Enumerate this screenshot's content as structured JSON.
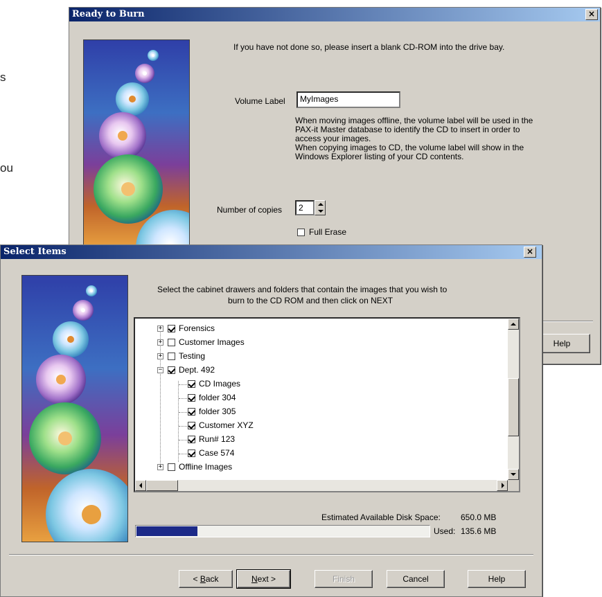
{
  "background_text": {
    "line1": "s",
    "line2": "ou"
  },
  "ready_to_burn": {
    "title": "Ready to Burn",
    "close_label": "×",
    "instruction": "If you have not done so, please insert a blank CD-ROM into the drive bay.",
    "volume_label_caption": "Volume Label",
    "volume_label_value": "MyImages",
    "volume_help_lines": [
      "When moving images offline, the volume label will be used in the",
      "PAX-it Master database to identify the CD to insert in order to",
      "access your images.",
      "When copying images to CD, the volume label will show in the",
      "Windows Explorer listing of your CD contents."
    ],
    "copies_caption": "Number of copies",
    "copies_value": "2",
    "full_erase_label": "Full Erase",
    "full_erase_checked": false,
    "help_button": "Help"
  },
  "select_items": {
    "title": "Select Items",
    "close_label": "×",
    "instruction_line1": "Select the cabinet drawers and folders that contain the images that you wish to",
    "instruction_line2": "burn to the CD ROM and then click on NEXT",
    "tree": [
      {
        "label": "Forensics",
        "checked": true,
        "level": 0,
        "expander": "+"
      },
      {
        "label": "Customer Images",
        "checked": false,
        "level": 0,
        "expander": "+"
      },
      {
        "label": "Testing",
        "checked": false,
        "level": 0,
        "expander": "+"
      },
      {
        "label": "Dept. 492",
        "checked": true,
        "level": 0,
        "expander": "−"
      },
      {
        "label": "CD Images",
        "checked": true,
        "level": 1
      },
      {
        "label": "folder 304",
        "checked": true,
        "level": 1
      },
      {
        "label": "folder 305",
        "checked": true,
        "level": 1
      },
      {
        "label": "Customer XYZ",
        "checked": true,
        "level": 1
      },
      {
        "label": "Run# 123",
        "checked": true,
        "level": 1
      },
      {
        "label": "Case 574",
        "checked": true,
        "level": 1
      },
      {
        "label": "Offline Images",
        "checked": false,
        "level": 0,
        "expander": "+"
      }
    ],
    "disk_space_label": "Estimated Available Disk Space:",
    "disk_space_value": "650.0 MB",
    "used_label": "Used:",
    "used_value": "135.6 MB",
    "used_fraction": 0.209,
    "buttons": {
      "back_u": "B",
      "back_rest": "ack",
      "back_prefix": "< ",
      "next_u": "N",
      "next_rest": "ext >",
      "finish": "Finish",
      "cancel": "Cancel",
      "help": "Help"
    }
  },
  "colors": {
    "progress": "#1c2a88",
    "title_bar": "#0a246a",
    "dialog_bg": "#d4d0c8"
  }
}
